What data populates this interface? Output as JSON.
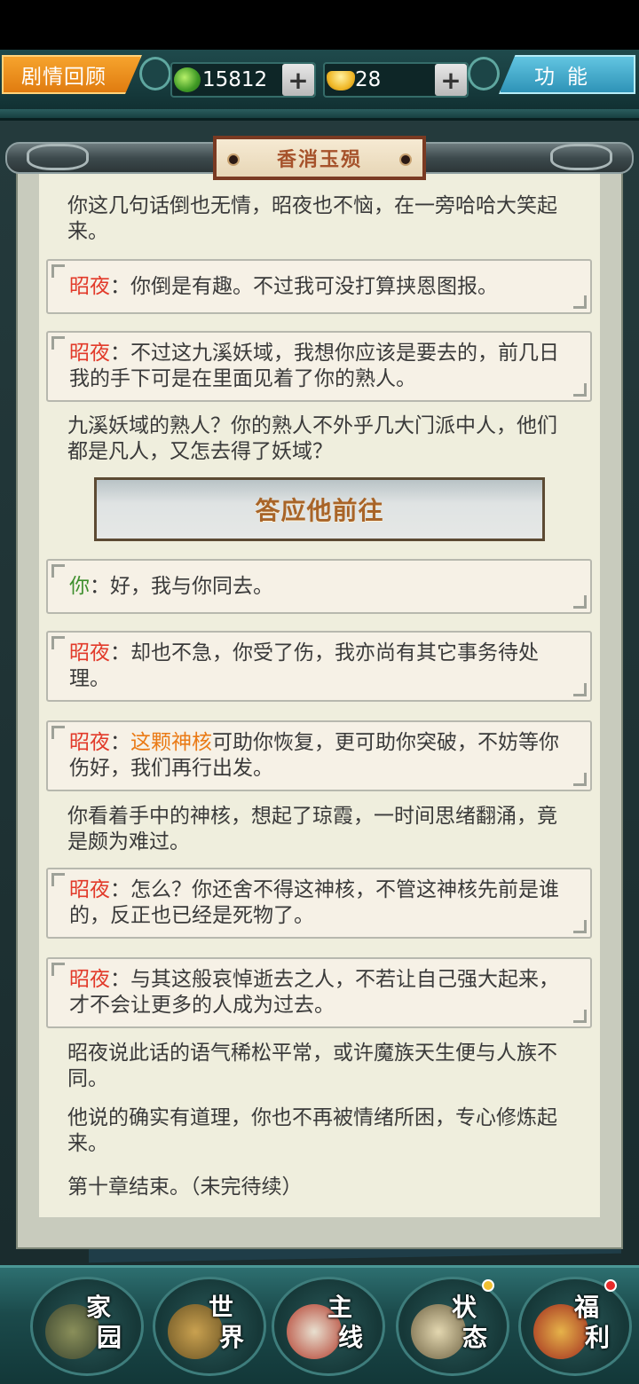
{
  "topbar": {
    "story_label": "剧情回顾",
    "jade_amount": "15812",
    "gold_amount": "28",
    "plus": "+",
    "function_label": "功能"
  },
  "title": "香消玉殒",
  "dialogue": {
    "p1": "你这几句话倒也无情，昭夜也不恼，在一旁哈哈大笑起来。",
    "b1_speaker": "昭夜",
    "b1_text": "：你倒是有趣。不过我可没打算挟恩图报。",
    "b2_speaker": "昭夜",
    "b2_text": "：不过这九溪妖域，我想你应该是要去的，前几日我的手下可是在里面见着了你的熟人。",
    "p2": "九溪妖域的熟人？你的熟人不外乎几大门派中人，他们都是凡人，又怎去得了妖域？",
    "choice": "答应他前往",
    "b3_speaker": "你",
    "b3_text": "：好，我与你同去。",
    "b4_speaker": "昭夜",
    "b4_text": "：却也不急，你受了伤，我亦尚有其它事务待处理。",
    "b5_speaker": "昭夜",
    "b5_colon": "：",
    "b5_highlight": "这颗神核",
    "b5_text": "可助你恢复，更可助你突破，不妨等你伤好，我们再行出发。",
    "p3": "你看着手中的神核，想起了琼霞，一时间思绪翻涌，竟是颇为难过。",
    "b6_speaker": "昭夜",
    "b6_text": "：怎么？你还舍不得这神核，不管这神核先前是谁的，反正也已经是死物了。",
    "b7_speaker": "昭夜",
    "b7_text": "：与其这般哀悼逝去之人，不若让自己强大起来，才不会让更多的人成为过去。",
    "p4": "昭夜说此话的语气稀松平常，或许魔族天生便与人族不同。",
    "p5": "他说的确实有道理，你也不再被情绪所困，专心修炼起来。",
    "p6": "第十章结束。（未完待续）"
  },
  "nav": [
    {
      "l1": "家",
      "l2": "园",
      "icon": "home-icon"
    },
    {
      "l1": "世",
      "l2": "界",
      "icon": "world-map-icon"
    },
    {
      "l1": "主",
      "l2": "线",
      "icon": "main-quest-icon"
    },
    {
      "l1": "状",
      "l2": "态",
      "icon": "status-bagua-icon"
    },
    {
      "l1": "福",
      "l2": "利",
      "icon": "welfare-bag-icon"
    }
  ],
  "colors": {
    "speaker_red": "#e23a2a",
    "speaker_green": "#3f8f2e",
    "highlight_orange": "#ea7a15",
    "story_button": "#f09a25",
    "function_button": "#3aa3c5"
  }
}
